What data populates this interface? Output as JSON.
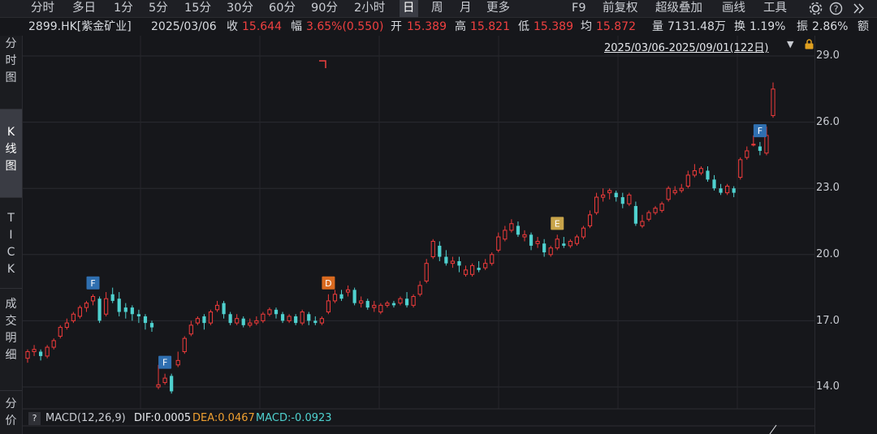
{
  "toolbar": {
    "tabs": [
      "分时",
      "多日",
      "1分",
      "5分",
      "15分",
      "30分",
      "60分",
      "90分",
      "2小时",
      "日",
      "周",
      "月",
      "更多"
    ],
    "active_tab": "日",
    "right_items": [
      "F9",
      "前复权",
      "超级叠加",
      "画线",
      "工具"
    ]
  },
  "info": {
    "code": "2899.HK[紫金矿业]",
    "date": "2025/03/06",
    "close_label": "收",
    "close": "15.644",
    "amp_label": "幅",
    "amp": "3.65%(0.550)",
    "open_label": "开",
    "open": "15.389",
    "high_label": "高",
    "high": "15.821",
    "low_label": "低",
    "low": "15.389",
    "avg_label": "均",
    "avg": "15.872",
    "vol_label": "量",
    "vol": "7131.48万",
    "turn_label": "换",
    "turn": "1.19%",
    "swing_label": "振",
    "swing": "2.86%",
    "amt_label": "额"
  },
  "sidebar": [
    {
      "label": "分\n时\n图"
    },
    {
      "label": "K\n线\n图"
    },
    {
      "label": "T\nI\nC\nK"
    },
    {
      "label": "成\n交\n明\n细"
    },
    {
      "label": "分\n价"
    }
  ],
  "range_label": "2025/03/06-2025/09/01(122日)",
  "macd": {
    "help": "?",
    "title": "MACD(12,26,9)",
    "dif": "DIF:0.0005",
    "dea": "DEA:0.0467",
    "macd": "MACD:-0.0923"
  },
  "colors": {
    "up": "#ef3b3b",
    "down": "#4fd1cf",
    "dif": "#e6e8ec",
    "dea": "#f0a030",
    "macd": "#4fd1cf"
  },
  "chart_data": {
    "type": "candlestick",
    "y_ticks": [
      "29.0",
      "26.0",
      "23.0",
      "20.0",
      "17.0",
      "14.0"
    ],
    "ylim": [
      13.5,
      29.2
    ],
    "candles": [
      [
        15.3,
        15.7,
        15.6,
        15.1
      ],
      [
        15.6,
        15.9,
        15.7,
        15.4
      ],
      [
        15.6,
        15.7,
        15.4,
        15.2
      ],
      [
        15.4,
        15.9,
        15.8,
        15.3
      ],
      [
        15.8,
        16.2,
        16.1,
        15.7
      ],
      [
        16.3,
        16.8,
        16.7,
        16.2
      ],
      [
        16.7,
        17.1,
        16.9,
        16.6
      ],
      [
        17.0,
        17.4,
        17.3,
        16.9
      ],
      [
        17.2,
        17.7,
        17.6,
        17.1
      ],
      [
        17.6,
        17.9,
        17.8,
        17.4
      ],
      [
        17.9,
        18.2,
        18.1,
        17.7
      ],
      [
        18.0,
        18.1,
        17.0,
        16.9
      ],
      [
        17.3,
        18.3,
        18.0,
        17.2
      ],
      [
        18.2,
        18.5,
        17.9,
        17.8
      ],
      [
        18.0,
        18.3,
        17.4,
        17.2
      ],
      [
        17.6,
        17.8,
        17.4,
        17.1
      ],
      [
        17.6,
        17.7,
        17.3,
        17.0
      ],
      [
        17.3,
        17.5,
        17.2,
        16.9
      ],
      [
        17.2,
        17.3,
        16.9,
        16.6
      ],
      [
        16.9,
        17.0,
        16.7,
        16.5
      ],
      [
        14.0,
        15.0,
        14.1,
        13.9
      ],
      [
        14.2,
        14.6,
        14.4,
        14.1
      ],
      [
        14.5,
        14.6,
        13.8,
        13.7
      ],
      [
        15.0,
        15.6,
        15.2,
        14.9
      ],
      [
        15.6,
        16.3,
        16.2,
        15.5
      ],
      [
        16.4,
        17.0,
        16.8,
        16.3
      ],
      [
        16.9,
        17.2,
        17.1,
        16.8
      ],
      [
        17.2,
        17.3,
        16.9,
        16.6
      ],
      [
        16.9,
        17.5,
        17.4,
        16.8
      ],
      [
        17.5,
        17.9,
        17.7,
        17.4
      ],
      [
        17.8,
        17.9,
        17.3,
        17.1
      ],
      [
        17.3,
        17.4,
        16.9,
        16.8
      ],
      [
        16.9,
        17.3,
        17.1,
        16.8
      ],
      [
        17.1,
        17.2,
        16.8,
        16.7
      ],
      [
        16.8,
        17.1,
        16.9,
        16.7
      ],
      [
        16.9,
        17.2,
        17.0,
        16.8
      ],
      [
        17.0,
        17.4,
        17.3,
        16.9
      ],
      [
        17.3,
        17.6,
        17.5,
        17.2
      ],
      [
        17.5,
        17.6,
        17.3,
        17.1
      ],
      [
        17.3,
        17.4,
        17.0,
        16.9
      ],
      [
        17.0,
        17.3,
        17.2,
        16.9
      ],
      [
        17.2,
        17.3,
        16.9,
        16.8
      ],
      [
        16.9,
        17.5,
        17.4,
        16.8
      ],
      [
        17.3,
        17.4,
        17.0,
        16.8
      ],
      [
        17.0,
        17.2,
        16.9,
        16.8
      ],
      [
        16.9,
        17.2,
        17.1,
        16.8
      ],
      [
        17.4,
        18.2,
        17.9,
        17.3
      ],
      [
        17.9,
        18.4,
        18.2,
        17.8
      ],
      [
        18.2,
        18.4,
        18.0,
        17.9
      ],
      [
        18.3,
        18.6,
        18.4,
        18.1
      ],
      [
        18.4,
        18.5,
        17.8,
        17.7
      ],
      [
        17.8,
        18.1,
        17.9,
        17.6
      ],
      [
        17.9,
        18.0,
        17.6,
        17.5
      ],
      [
        17.6,
        17.9,
        17.7,
        17.4
      ],
      [
        17.4,
        17.8,
        17.7,
        17.3
      ],
      [
        17.7,
        17.9,
        17.8,
        17.6
      ],
      [
        17.8,
        17.9,
        17.7,
        17.6
      ],
      [
        17.8,
        18.1,
        18.0,
        17.7
      ],
      [
        18.0,
        18.3,
        17.7,
        17.6
      ],
      [
        17.7,
        18.2,
        18.1,
        17.6
      ],
      [
        18.2,
        18.8,
        18.6,
        18.1
      ],
      [
        18.8,
        19.8,
        19.6,
        18.7
      ],
      [
        19.9,
        20.7,
        20.6,
        19.8
      ],
      [
        20.4,
        20.6,
        19.9,
        19.7
      ],
      [
        19.9,
        20.2,
        19.6,
        19.5
      ],
      [
        19.6,
        19.9,
        19.7,
        19.4
      ],
      [
        19.7,
        19.9,
        19.5,
        19.2
      ],
      [
        19.1,
        19.5,
        19.3,
        19.0
      ],
      [
        19.1,
        19.6,
        19.5,
        19.0
      ],
      [
        19.4,
        19.7,
        19.3,
        19.2
      ],
      [
        19.4,
        19.8,
        19.6,
        19.3
      ],
      [
        19.6,
        20.1,
        20.0,
        19.5
      ],
      [
        20.2,
        21.0,
        20.8,
        20.1
      ],
      [
        20.7,
        21.3,
        21.1,
        20.6
      ],
      [
        21.1,
        21.6,
        21.4,
        21.0
      ],
      [
        21.3,
        21.5,
        20.9,
        20.8
      ],
      [
        20.8,
        21.1,
        20.9,
        20.6
      ],
      [
        20.9,
        21.0,
        20.4,
        20.2
      ],
      [
        20.5,
        20.8,
        20.6,
        20.3
      ],
      [
        20.5,
        20.7,
        20.1,
        19.9
      ],
      [
        20.0,
        20.4,
        20.3,
        19.9
      ],
      [
        20.3,
        20.9,
        20.7,
        20.2
      ],
      [
        20.5,
        20.8,
        20.4,
        20.3
      ],
      [
        20.4,
        20.7,
        20.6,
        20.3
      ],
      [
        20.5,
        20.9,
        20.8,
        20.4
      ],
      [
        20.8,
        21.3,
        21.2,
        20.7
      ],
      [
        21.3,
        22.0,
        21.8,
        21.2
      ],
      [
        21.9,
        22.8,
        22.6,
        21.8
      ],
      [
        22.6,
        23.0,
        22.7,
        22.4
      ],
      [
        22.8,
        23.0,
        22.9,
        22.5
      ],
      [
        22.8,
        22.9,
        22.6,
        22.4
      ],
      [
        22.6,
        22.8,
        22.3,
        22.1
      ],
      [
        22.3,
        22.8,
        22.7,
        22.2
      ],
      [
        22.2,
        22.4,
        21.4,
        21.3
      ],
      [
        21.3,
        21.8,
        21.5,
        21.2
      ],
      [
        21.6,
        22.0,
        21.9,
        21.5
      ],
      [
        21.9,
        22.2,
        22.1,
        21.8
      ],
      [
        22.0,
        22.4,
        22.3,
        21.9
      ],
      [
        22.5,
        23.1,
        23.0,
        22.4
      ],
      [
        22.8,
        23.1,
        22.9,
        22.7
      ],
      [
        22.9,
        23.2,
        23.0,
        22.8
      ],
      [
        23.1,
        23.8,
        23.6,
        23.0
      ],
      [
        23.6,
        24.1,
        23.8,
        23.5
      ],
      [
        23.7,
        24.0,
        23.9,
        23.6
      ],
      [
        23.8,
        24.0,
        23.4,
        23.3
      ],
      [
        23.4,
        23.6,
        23.0,
        22.9
      ],
      [
        23.0,
        23.2,
        22.8,
        22.7
      ],
      [
        22.8,
        23.2,
        23.1,
        22.7
      ],
      [
        23.0,
        23.1,
        22.8,
        22.6
      ],
      [
        23.5,
        24.4,
        24.3,
        23.4
      ],
      [
        24.4,
        24.9,
        24.7,
        24.3
      ],
      [
        25.0,
        25.4,
        25.0,
        24.9
      ],
      [
        24.9,
        25.1,
        24.7,
        24.5
      ],
      [
        24.6,
        25.8,
        25.4,
        24.5
      ],
      [
        26.3,
        27.8,
        27.5,
        26.2
      ]
    ],
    "markers": [
      {
        "label": "F",
        "index": 10,
        "color": "#2f6fb0"
      },
      {
        "label": "F",
        "index": 21,
        "color": "#2f6fb0"
      },
      {
        "label": "D",
        "index": 46,
        "color": "#d96a20"
      },
      {
        "label": "E",
        "index": 81,
        "color": "#c8a44a"
      },
      {
        "label": "F",
        "index": 112,
        "color": "#2f6fb0"
      }
    ]
  }
}
